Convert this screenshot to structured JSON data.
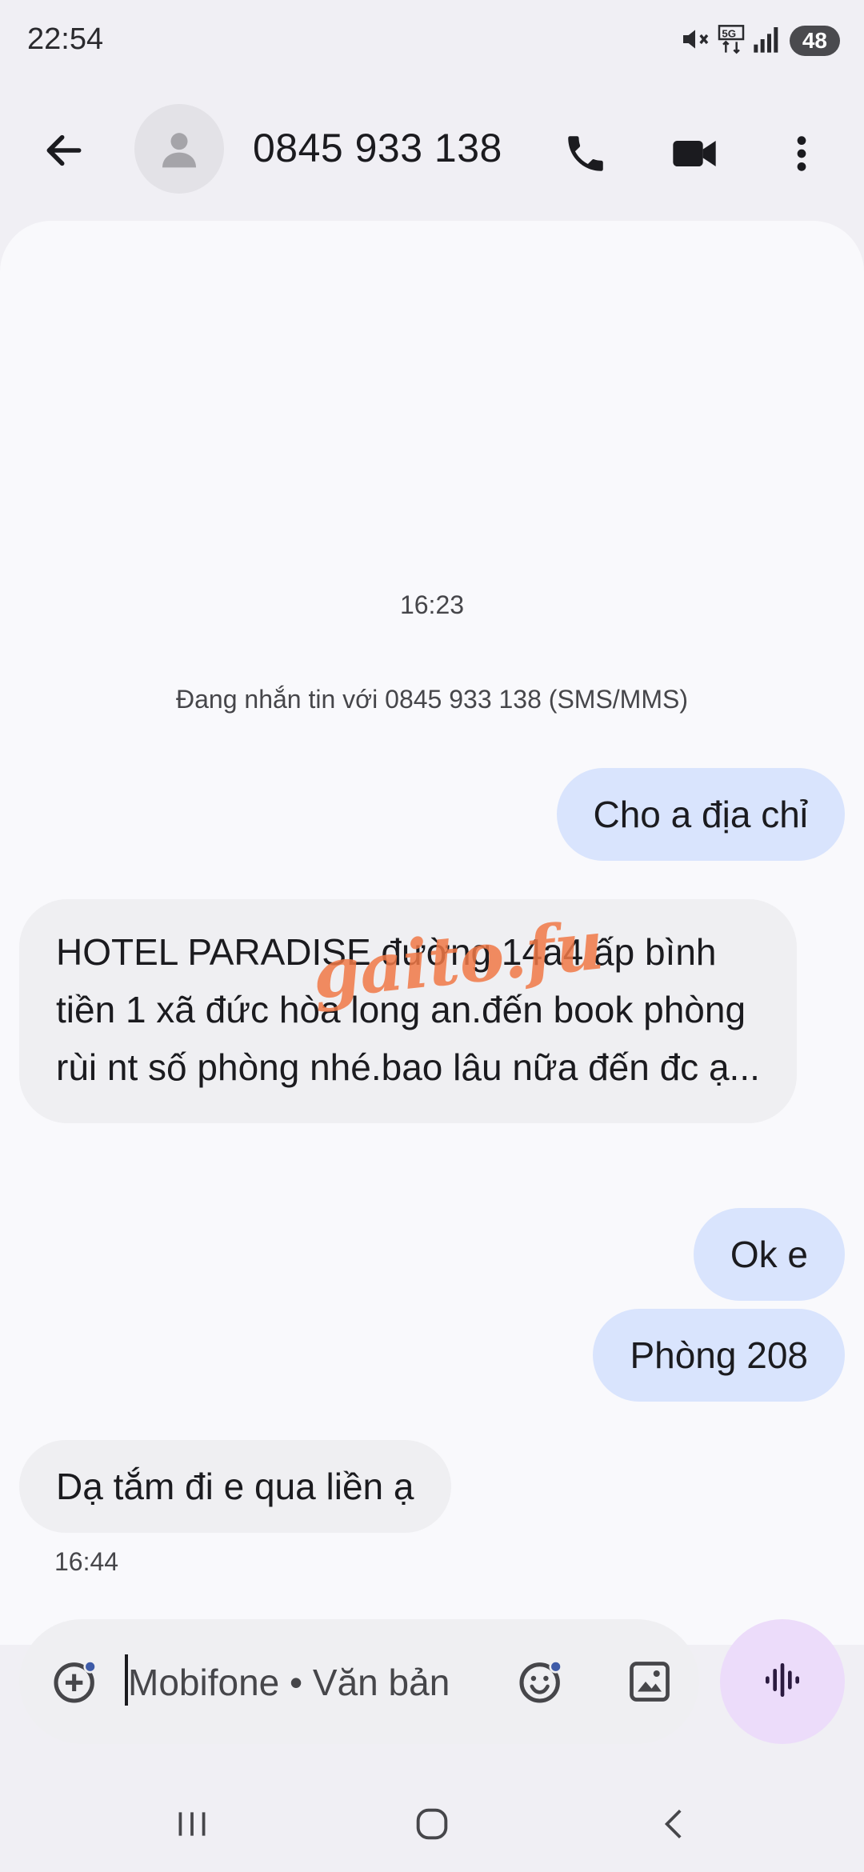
{
  "status_bar": {
    "time": "22:54",
    "battery": "48"
  },
  "header": {
    "contact": "0845 933 138"
  },
  "conversation": {
    "time_top": "16:23",
    "info": "Đang nhắn tin với 0845 933 138 (SMS/MMS)",
    "messages": [
      {
        "text": "Cho a địa chỉ",
        "direction": "outgoing"
      },
      {
        "text": "HOTEL PARADISE đường 14a4 ấp bình tiền 1 xã đức hòa long an.đến book phòng rùi nt số phòng nhé.bao lâu nữa đến đc ạ...",
        "direction": "incoming"
      },
      {
        "text": "Ok e",
        "direction": "outgoing"
      },
      {
        "text": "Phòng 208",
        "direction": "outgoing"
      },
      {
        "text": "Dạ tắm đi e qua liền ạ",
        "direction": "incoming"
      }
    ],
    "last_time": "16:44"
  },
  "watermark": "gaito.fu",
  "compose": {
    "placeholder": "Mobifone • Văn bản"
  },
  "colors": {
    "accent_purple": "#ecdcfa",
    "outgoing_bubble": "#d9e4fd",
    "incoming_bubble": "#efeff2"
  },
  "icons": [
    "back-icon",
    "phone-icon",
    "video-icon",
    "more-icon",
    "add-icon",
    "emoji-icon",
    "gallery-icon",
    "voice-icon",
    "recents-icon",
    "home-icon",
    "nav-back-icon"
  ]
}
